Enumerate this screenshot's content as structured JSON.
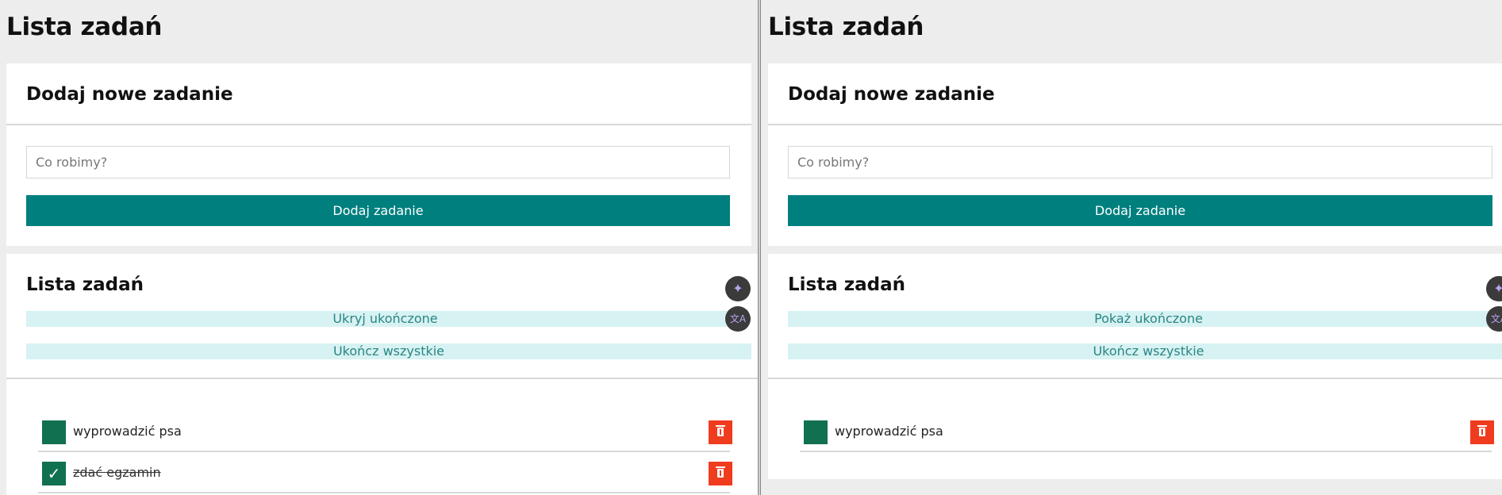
{
  "app": {
    "title": "Lista zadań"
  },
  "left": {
    "add_card": {
      "title": "Dodaj nowe zadanie",
      "input_placeholder": "Co robimy?",
      "input_value": "",
      "add_label": "Dodaj zadanie"
    },
    "list_card": {
      "title": "Lista zadań",
      "toggle_completed_label": "Ukryj ukończone",
      "complete_all_label": "Ukończ wszystkie",
      "tasks": [
        {
          "text": "wyprowadzić psa",
          "done": false,
          "check": ""
        },
        {
          "text": "zdać egzamin",
          "done": true,
          "check": "✓"
        }
      ]
    }
  },
  "right": {
    "add_card": {
      "title": "Dodaj nowe zadanie",
      "input_placeholder": "Co robimy?",
      "input_value": "",
      "add_label": "Dodaj zadanie"
    },
    "list_card": {
      "title": "Lista zadań",
      "toggle_completed_label": "Pokaż ukończone",
      "complete_all_label": "Ukończ wszystkie",
      "tasks": [
        {
          "text": "wyprowadzić psa",
          "done": false,
          "check": ""
        }
      ]
    }
  },
  "extension": {
    "ai_icon": "sparkle-icon",
    "translate_icon": "translate-icon",
    "ai_glyph": "✦",
    "translate_glyph": "文A"
  },
  "colors": {
    "accent": "#007f7f",
    "toggle_bg": "#d7f2f2",
    "check_bg": "#10704f",
    "delete_bg": "#f03c1e"
  }
}
